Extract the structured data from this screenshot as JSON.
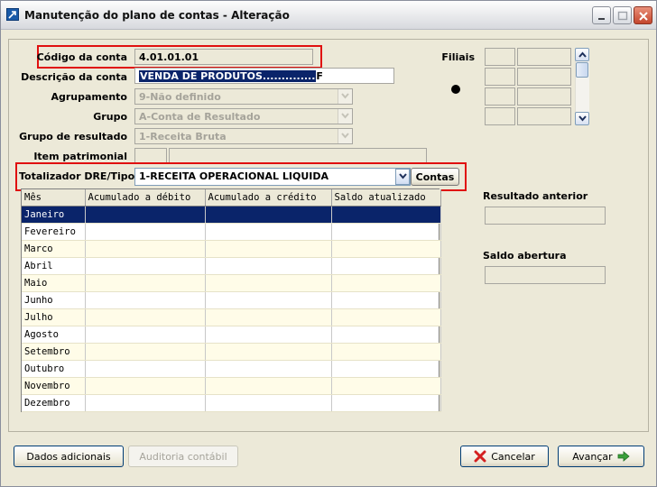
{
  "window": {
    "title": "Manutenção do plano de contas - Alteração"
  },
  "form": {
    "codigo": {
      "label": "Código da conta",
      "value": "4.01.01.01"
    },
    "descricao": {
      "label": "Descrição da conta",
      "value_selected": "VENDA DE PRODUTOS..............",
      "value_tail": "F"
    },
    "agrupamento": {
      "label": "Agrupamento",
      "value": "9-Não definido"
    },
    "grupo": {
      "label": "Grupo",
      "value": "A-Conta de Resultado"
    },
    "grupo_resultado": {
      "label": "Grupo de resultado",
      "value": "1-Receita Bruta"
    },
    "item_patrimonial": {
      "label": "Item patrimonial",
      "value": ""
    },
    "totalizador": {
      "label": "Totalizador DRE/Tipo",
      "value": "1-RECEITA OPERACIONAL LIQUIDA",
      "button": "Contas"
    }
  },
  "filiais": {
    "label": "Filiais"
  },
  "grid": {
    "columns": [
      "Mês",
      "Acumulado a débito",
      "Acumulado a crédito",
      "Saldo atualizado"
    ],
    "rows": [
      "Janeiro",
      "Fevereiro",
      "Marco",
      "Abril",
      "Maio",
      "Junho",
      "Julho",
      "Agosto",
      "Setembro",
      "Outubro",
      "Novembro",
      "Dezembro"
    ],
    "selected_row": "Janeiro"
  },
  "resultado_anterior": {
    "label": "Resultado anterior",
    "value": ""
  },
  "saldo_abertura": {
    "label": "Saldo abertura",
    "value": ""
  },
  "buttons": {
    "dados_adicionais": "Dados adicionais",
    "auditoria": "Auditoria contábil",
    "cancelar": "Cancelar",
    "avancar": "Avançar"
  },
  "colors": {
    "selection": "#0a246a",
    "highlight": "#e01010",
    "alt_row": "#fffce8"
  }
}
